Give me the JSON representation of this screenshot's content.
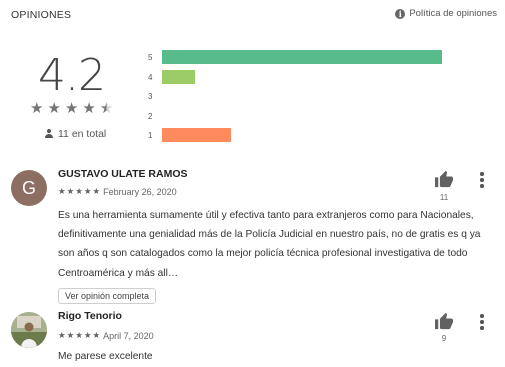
{
  "header": {
    "title": "OPINIONES",
    "policy_link": "Política de opiniones"
  },
  "summary": {
    "rating": "4.2",
    "stars_filled": 4.2,
    "total_label": "11 en total",
    "distribution": [
      {
        "label": "5",
        "fraction": 0.94,
        "color": "#57bb8a"
      },
      {
        "label": "4",
        "fraction": 0.11,
        "color": "#9ccc65"
      },
      {
        "label": "3",
        "fraction": 0,
        "color": "#ffcf02"
      },
      {
        "label": "2",
        "fraction": 0,
        "color": "#ff9f00"
      },
      {
        "label": "1",
        "fraction": 0.23,
        "color": "#ff8a5b"
      }
    ]
  },
  "reviews": [
    {
      "avatar_letter": "G",
      "name": "GUSTAVO ULATE RAMOS",
      "stars": "★★★★★",
      "date": "February 26, 2020",
      "text": "Es una herramienta sumamente útil y efectiva tanto para extranjeros como para Nacionales, definitivamente una genialidad más de la Policía Judicial en nuestro país, no de gratis es q ya son años q son catalogados como la mejor policía técnica profesional investigativa de todo Centroamérica y más all…",
      "more_label": "Ver opinión completa",
      "helpful_count": "11"
    },
    {
      "name": "Rigo Tenorio",
      "stars": "★★★★★",
      "date": "April 7, 2020",
      "text": "Me parese excelente",
      "helpful_count": "9"
    }
  ]
}
